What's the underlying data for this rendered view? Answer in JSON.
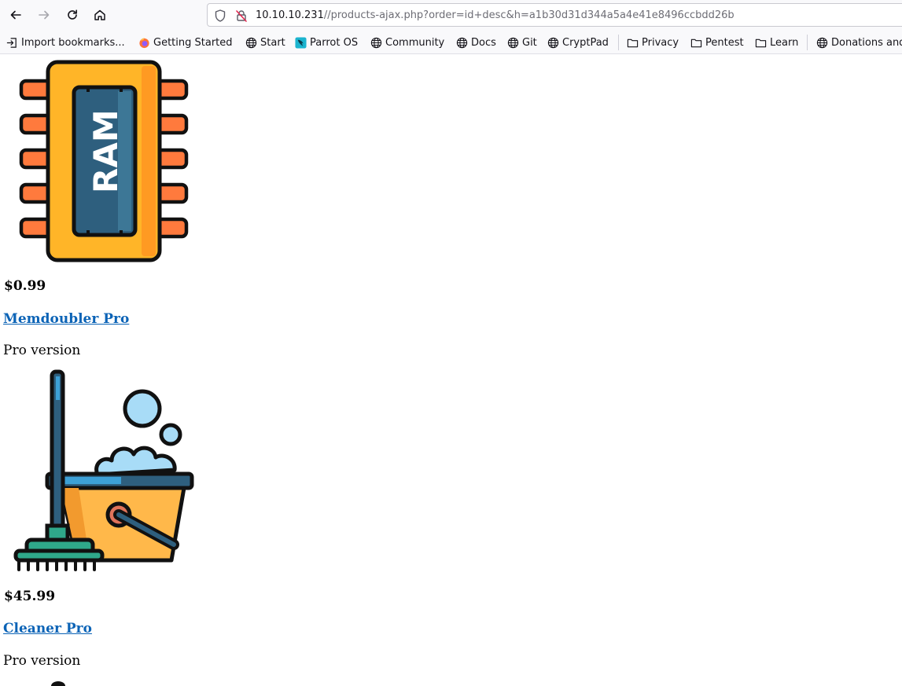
{
  "browser": {
    "url_host": "10.10.10.231",
    "url_path": "//products-ajax.php?order=id+desc&h=a1b30d31d344a5a4e41e8496ccbdd26b"
  },
  "bookmarks": {
    "import": "Import bookmarks...",
    "getting_started": "Getting Started",
    "start": "Start",
    "parrot": "Parrot OS",
    "community": "Community",
    "docs": "Docs",
    "git": "Git",
    "cryptpad": "CryptPad",
    "privacy": "Privacy",
    "pentest": "Pentest",
    "learn": "Learn",
    "donations": "Donations and"
  },
  "products": [
    {
      "image_icon": "ram-chip-icon",
      "image_text": "RAM",
      "price": "$0.99",
      "name": "Memdoubler Pro",
      "description": "Pro version"
    },
    {
      "image_icon": "mop-bucket-icon",
      "price": "$45.99",
      "name": "Cleaner Pro",
      "description": "Pro version"
    }
  ],
  "colors": {
    "link": "#0b63b6",
    "chip_body": "#ffb528",
    "chip_pins": "#ff7a3d",
    "chip_label_bg": "#2e5f7e",
    "bucket": "#ffb84a",
    "bubbles": "#a8dcf7",
    "mop_head": "#2fa88a"
  }
}
